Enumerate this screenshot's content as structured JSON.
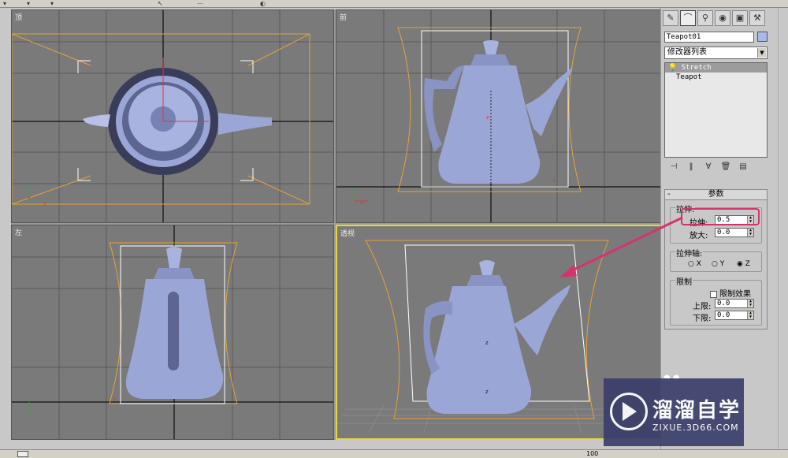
{
  "viewports": {
    "top": {
      "label": "顶"
    },
    "front": {
      "label": "前"
    },
    "left": {
      "label": "左"
    },
    "perspective": {
      "label": "透视"
    }
  },
  "command_panel": {
    "object_name": "Teapot01",
    "object_color": "#a8b8e8",
    "modifier_list_label": "修改器列表",
    "stack": [
      {
        "label": "Stretch",
        "selected": true
      },
      {
        "label": "Teapot",
        "selected": false
      }
    ],
    "rollout": {
      "title": "参数",
      "stretch_group": {
        "title": "拉伸:",
        "stretch_label": "拉伸:",
        "stretch_value": "0.5",
        "amplify_label": "放大:",
        "amplify_value": "0.0"
      },
      "axis_group": {
        "title": "拉伸轴:",
        "x_label": "X",
        "y_label": "Y",
        "z_label": "Z",
        "selected": "Z"
      },
      "limit_group": {
        "title": "限制",
        "limit_effect_label": "限制效果",
        "upper_label": "上限:",
        "upper_value": "0.0",
        "lower_label": "下限:",
        "lower_value": "0.0"
      }
    }
  },
  "status": {
    "zoom_value": "100"
  },
  "watermark": {
    "brand": "溜溜自学",
    "url": "ZIXUE.3D66.COM"
  },
  "colors": {
    "viewport_bg": "#7a7a7a",
    "gizmo": "#e3a33a",
    "teapot": "#9aa6d6",
    "active_border": "#e6d832",
    "callout": "#d6336c"
  }
}
